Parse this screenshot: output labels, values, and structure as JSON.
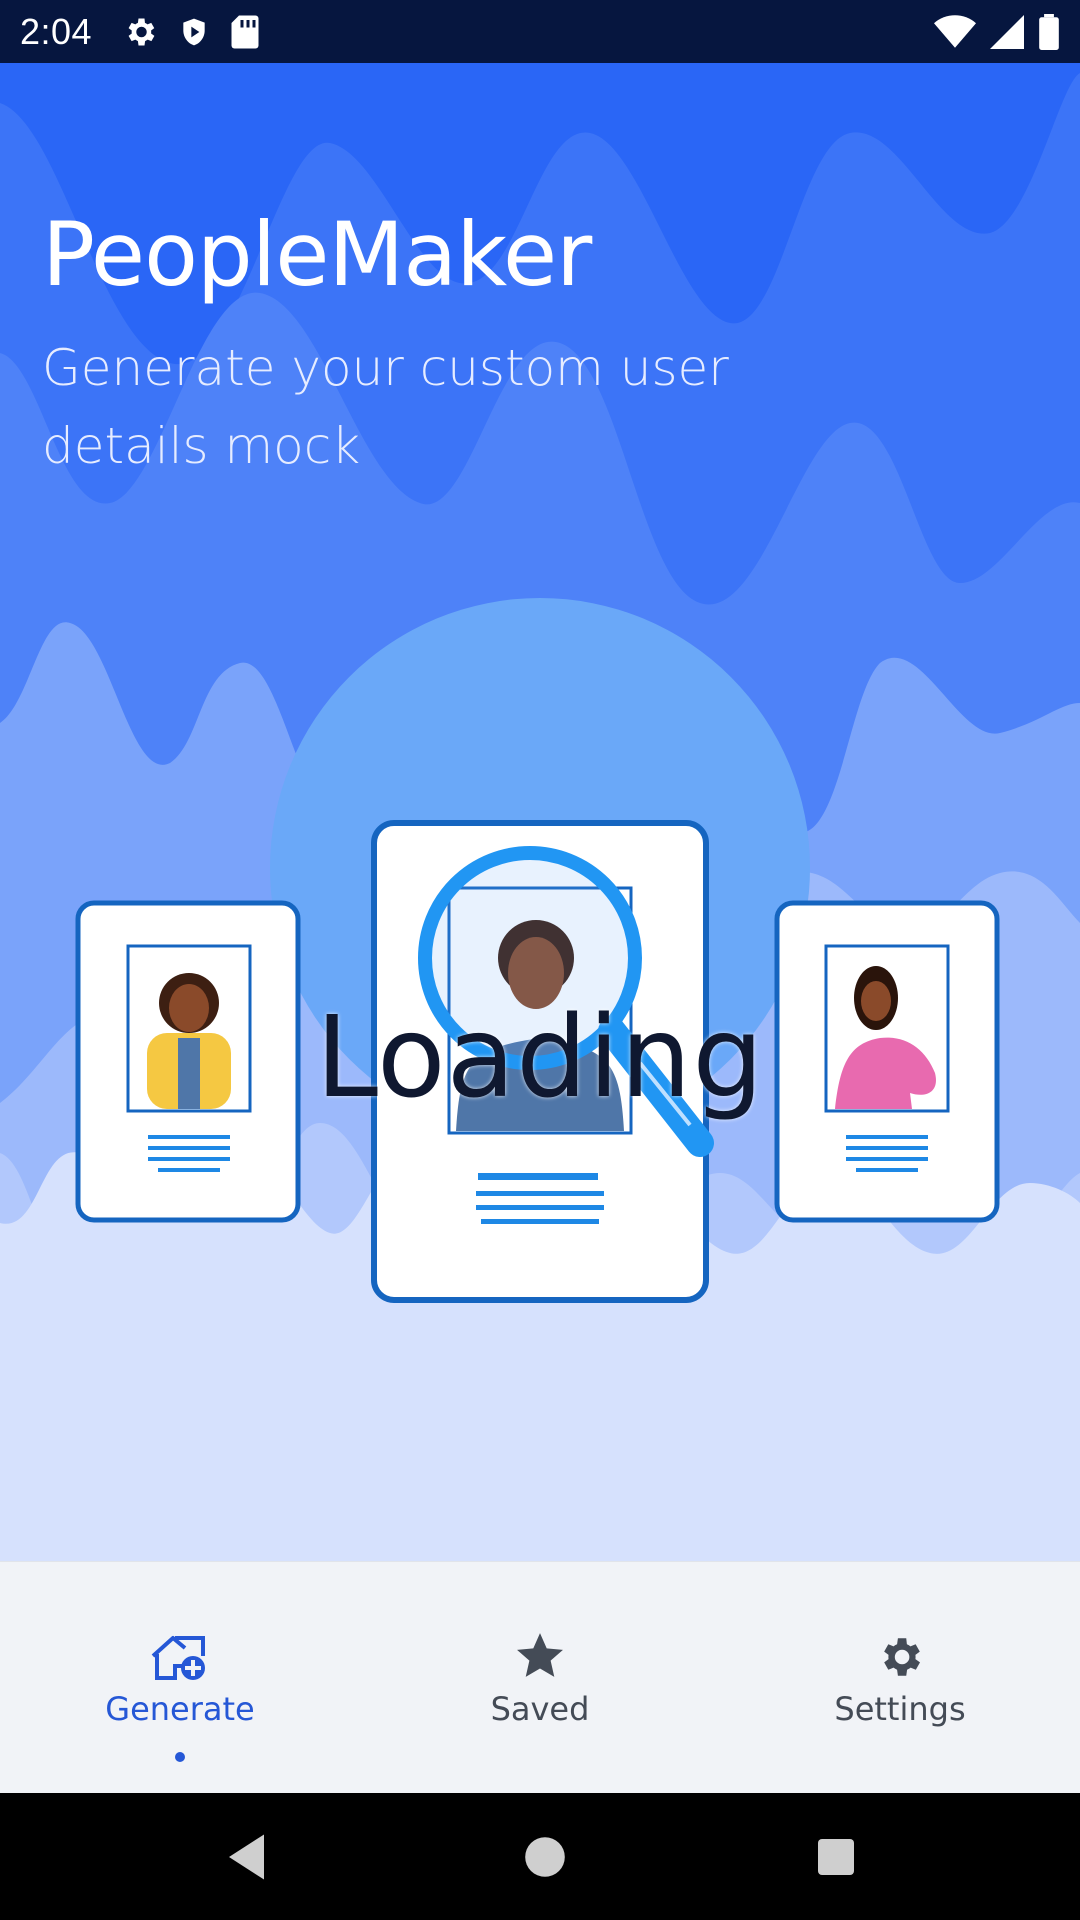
{
  "status_bar": {
    "time": "2:04",
    "icons": [
      "gear-icon",
      "shield-icon",
      "sd-card-icon",
      "wifi-icon",
      "signal-icon",
      "battery-icon"
    ]
  },
  "header": {
    "title": "PeopleMaker",
    "subtitle": "Generate your custom user details mock"
  },
  "illustration": {
    "loading_label": "Loading"
  },
  "bottom_nav": {
    "items": [
      {
        "label": "Generate",
        "icon": "home-add-icon",
        "active": true
      },
      {
        "label": "Saved",
        "icon": "star-icon",
        "active": false
      },
      {
        "label": "Settings",
        "icon": "gear-icon",
        "active": false
      }
    ]
  },
  "system_nav": {
    "icons": [
      "back-icon",
      "home-icon",
      "recents-icon"
    ]
  },
  "colors": {
    "accent": "#2557d6",
    "background": "#2563f5",
    "card_border": "#1565c0",
    "status_bar": "#06163f"
  }
}
